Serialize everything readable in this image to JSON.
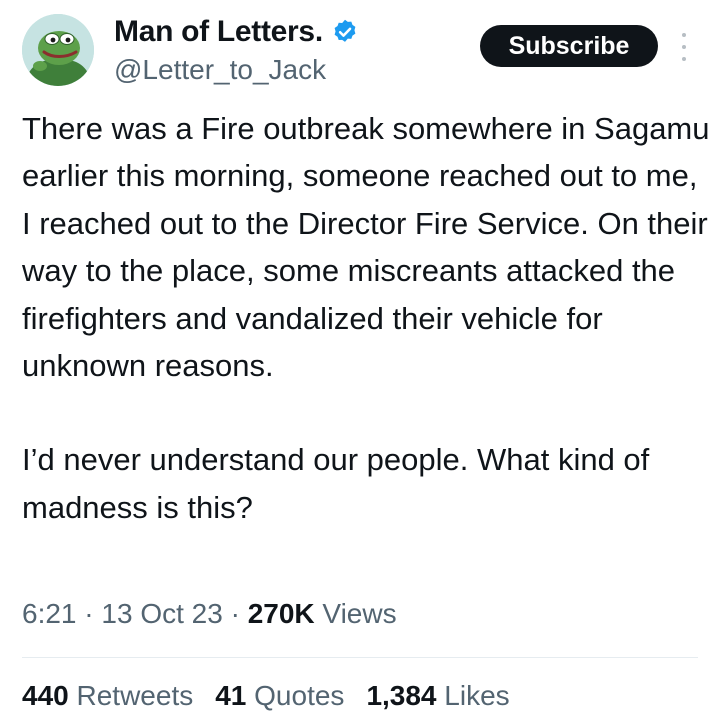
{
  "author": {
    "display_name": "Man of Letters.",
    "handle": "@Letter_to_Jack",
    "verified": true,
    "avatar_icon": "frog-avatar-icon"
  },
  "actions": {
    "subscribe_label": "Subscribe",
    "more_icon": "more-vertical-icon"
  },
  "tweet": {
    "paragraphs": [
      "There was a Fire outbreak somewhere in Sagamu earlier this morning, someone reached out to me, I reached out to the Director Fire Service. On their way to the place, some miscreants attacked the firefighters and vandalized their vehicle for unknown reasons.",
      "I’d never understand our people. What kind of madness is this?"
    ]
  },
  "meta": {
    "time": "6:21",
    "separator": "·",
    "date": "13 Oct 23",
    "views_count": "270K",
    "views_label": "Views"
  },
  "stats": {
    "retweets_count": "440",
    "retweets_label": "Retweets",
    "quotes_count": "41",
    "quotes_label": "Quotes",
    "likes_count": "1,384",
    "likes_label": "Likes"
  },
  "colors": {
    "verified_blue": "#1d9bf0",
    "text_primary": "#0f1419",
    "text_secondary": "#536471",
    "button_bg": "#0f1419"
  }
}
